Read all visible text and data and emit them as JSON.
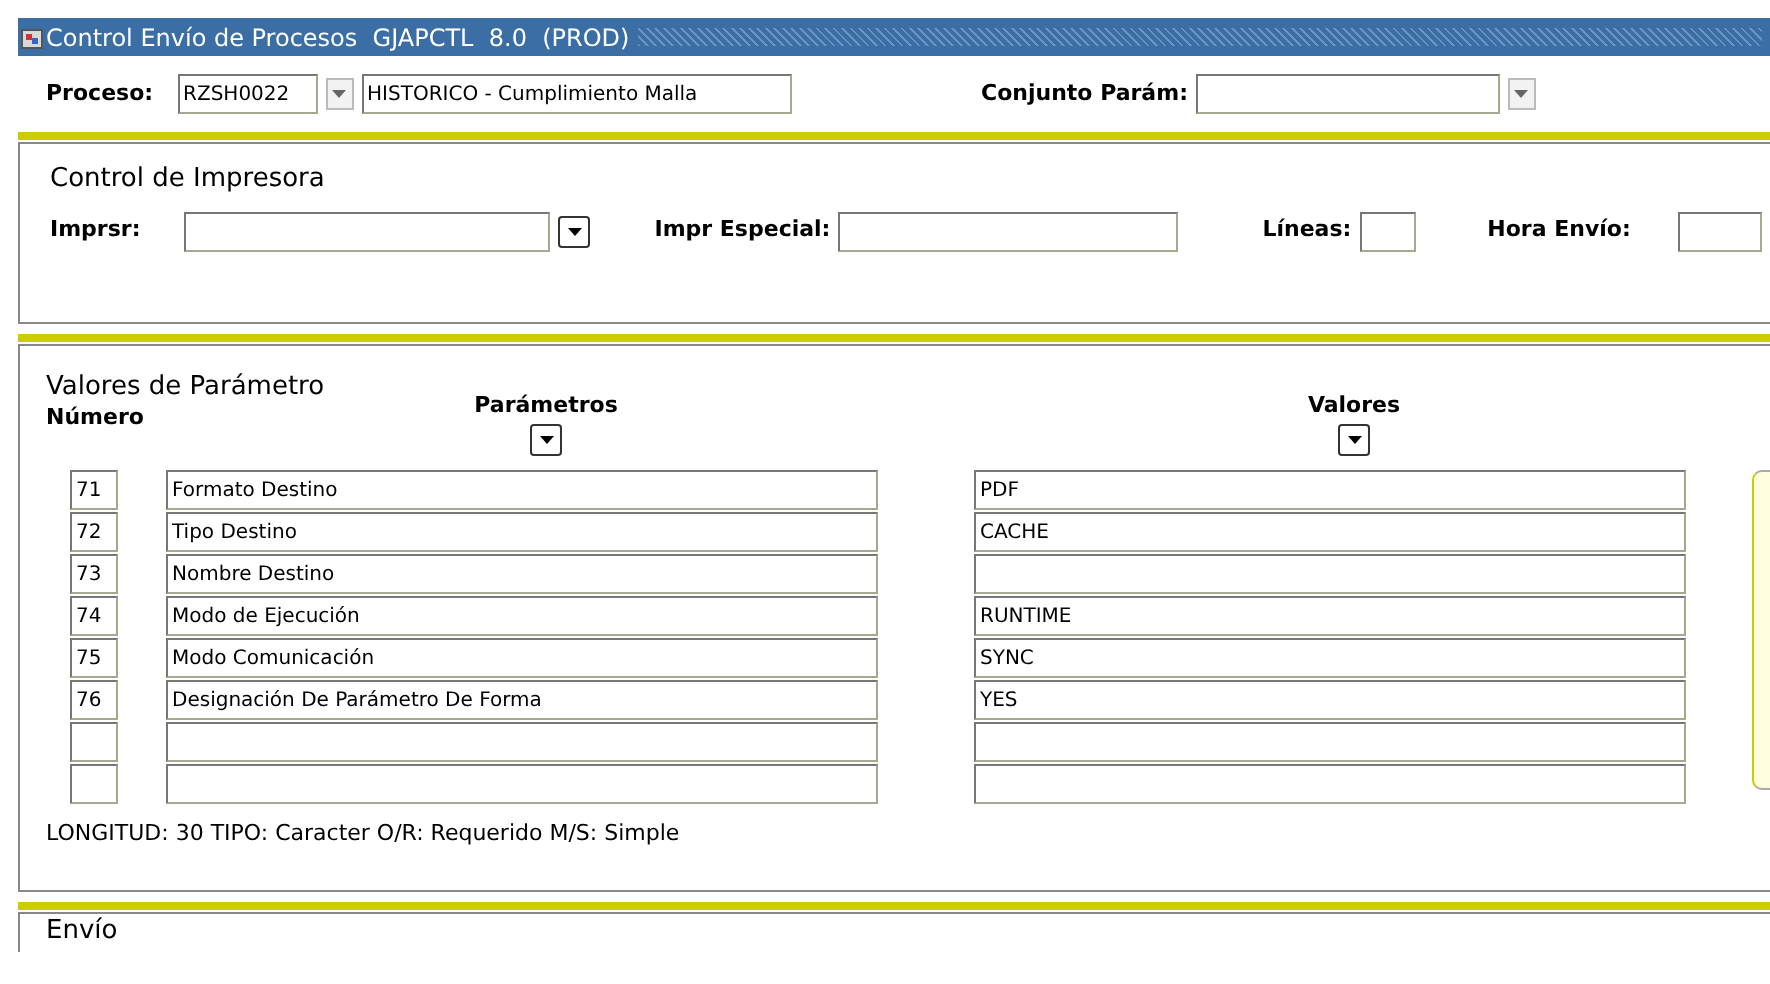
{
  "window": {
    "title": "Control Envío de Procesos  GJAPCTL  8.0  (PROD)"
  },
  "key_block": {
    "process_label": "Proceso:",
    "process_code": "RZSH0022",
    "process_name": "HISTORICO - Cumplimiento Malla",
    "param_set_label": "Conjunto Parám:"
  },
  "printer": {
    "title": "Control de Impresora",
    "printer_label": "Imprsr:",
    "special_label": "Impr Especial:",
    "lines_label": "Líneas:",
    "time_label": "Hora Envío:"
  },
  "parameters": {
    "title": "Valores de Parámetro",
    "columns": [
      "Número",
      "Parámetros",
      "Valores"
    ],
    "rows": [
      {
        "number": "71",
        "parameter": "Formato Destino",
        "value": "PDF"
      },
      {
        "number": "72",
        "parameter": "Tipo Destino",
        "value": "CACHE"
      },
      {
        "number": "73",
        "parameter": "Nombre Destino",
        "value": ""
      },
      {
        "number": "74",
        "parameter": "Modo de Ejecución",
        "value": "RUNTIME"
      },
      {
        "number": "75",
        "parameter": "Modo Comunicación",
        "value": "SYNC"
      },
      {
        "number": "76",
        "parameter": "Designación De Parámetro De Forma",
        "value": "YES"
      },
      {
        "number": "",
        "parameter": "",
        "value": ""
      },
      {
        "number": "",
        "parameter": "",
        "value": ""
      }
    ],
    "hint": "LONGITUD: 30 TIPO: Caracter O/R: Requerido M/S: Simple"
  },
  "submission": {
    "title": "Envío"
  }
}
